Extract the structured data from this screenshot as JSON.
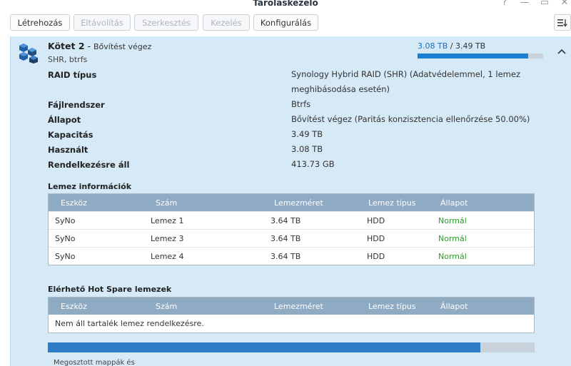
{
  "window": {
    "title": "Tároláskezelő",
    "help_glyph": "?",
    "minimize_glyph": "—",
    "maximize_glyph": "▭",
    "close_glyph": "✕"
  },
  "toolbar": {
    "create": "Létrehozás",
    "remove": "Eltávolítás",
    "edit": "Szerkesztés",
    "manage": "Kezelés",
    "configure": "Konfigurálás"
  },
  "volume": {
    "name": "Kötet 2",
    "separator": " - ",
    "status": "Bővítést végez",
    "subtitle": "SHR, btrfs",
    "used": "3.08 TB",
    "slash": " / ",
    "total": "3.49 TB",
    "usage_fraction": 0.8825
  },
  "properties": [
    {
      "label": "RAID típus",
      "value": "Synology Hybrid RAID (SHR) (Adatvédelemmel, 1 lemez meghibásodása esetén)"
    },
    {
      "label": "Fájlrendszer",
      "value": "Btrfs"
    },
    {
      "label": "Állapot",
      "value": "Bővítést végez (Paritás konzisztencia ellenőrzése 50.00%)"
    },
    {
      "label": "Kapacitás",
      "value": "3.49 TB"
    },
    {
      "label": "Használt",
      "value": "3.08 TB"
    },
    {
      "label": "Rendelkezésre áll",
      "value": "413.73 GB"
    }
  ],
  "disk_info": {
    "heading": "Lemez információk",
    "columns": [
      "Eszköz",
      "Szám",
      "Lemezméret",
      "Lemez típus",
      "Állapot"
    ],
    "rows": [
      [
        "SyNo",
        "Lemez 1",
        "3.64 TB",
        "HDD",
        "Normál"
      ],
      [
        "SyNo",
        "Lemez 3",
        "3.64 TB",
        "HDD",
        "Normál"
      ],
      [
        "SyNo",
        "Lemez 4",
        "3.64 TB",
        "HDD",
        "Normál"
      ]
    ]
  },
  "hot_spare": {
    "heading": "Elérhető Hot Spare lemezek",
    "columns": [
      "Eszköz",
      "Szám",
      "Lemezméret",
      "Lemez típus",
      "Állapot"
    ],
    "empty_text": "Nem áll tartalék lemez rendelkezésre."
  },
  "progress": {
    "fraction": 0.888
  },
  "shared_folders_label": "Megosztott mappák és",
  "colors": {
    "accent": "#1b7fd4",
    "panel_bg": "#d6e9f7",
    "grid_header": "#8faac3",
    "ok_status": "#2e9a2e"
  },
  "icons": {
    "volume": "stacked-cubes-icon",
    "collapse": "chevron-up-icon",
    "sort": "sort-list-icon"
  }
}
